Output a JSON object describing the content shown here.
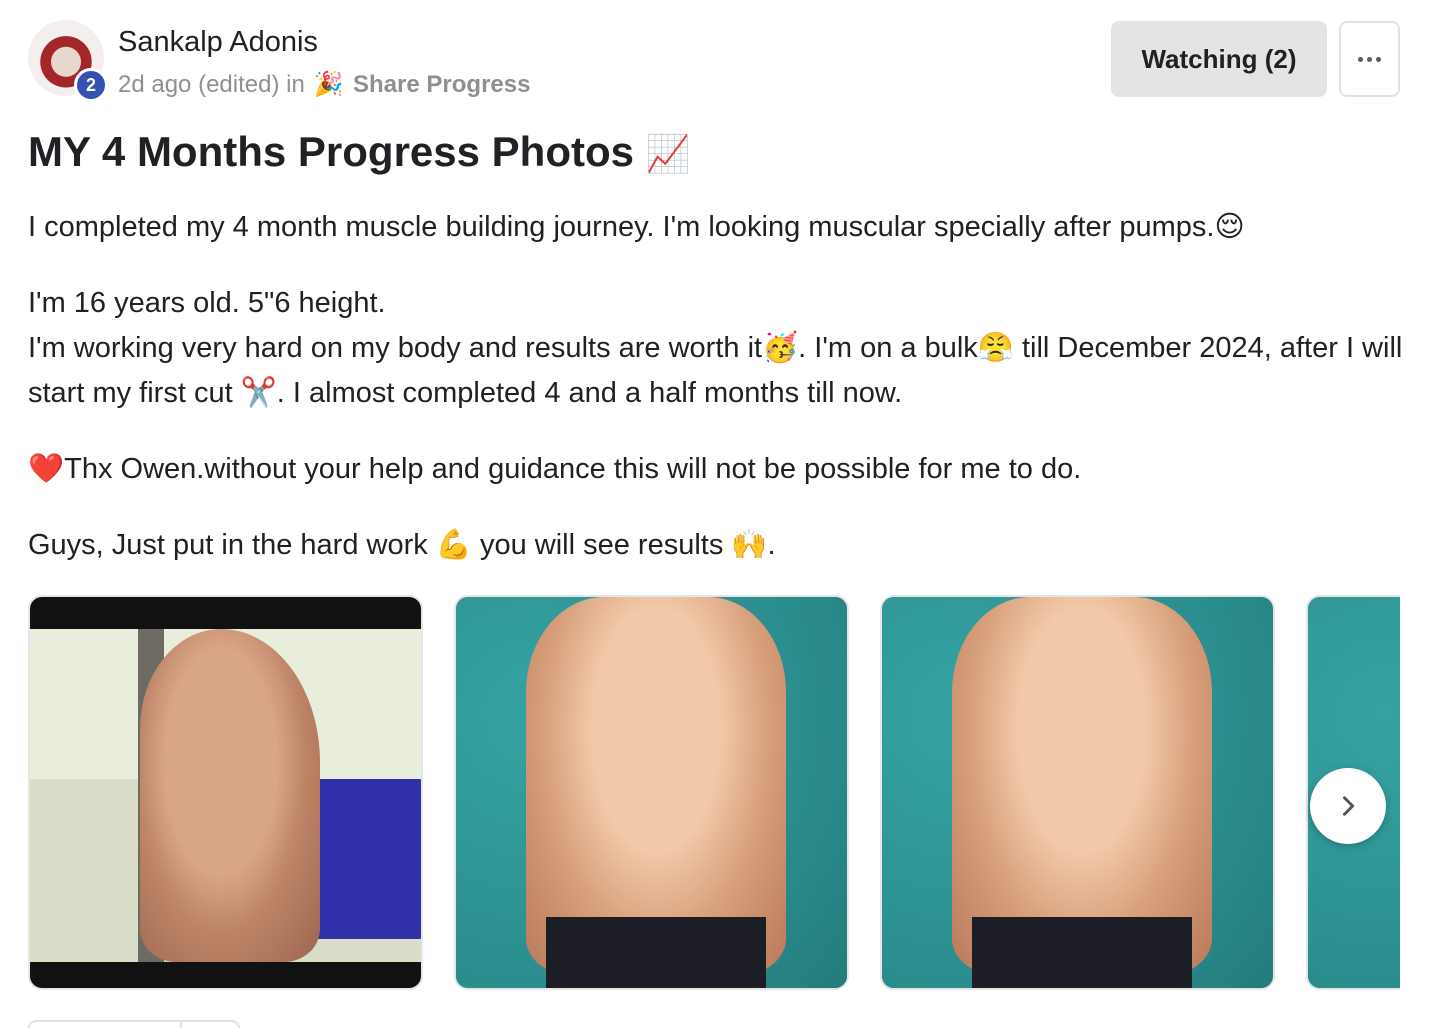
{
  "post": {
    "author": "Sankalp Adonis",
    "level": "2",
    "time": "2d ago (edited) in",
    "category_icon": "🎉",
    "category": "Share Progress",
    "watch_label": "Watching (2)",
    "more_icon": "ellipsis-icon",
    "title": "MY 4 Months Progress Photos",
    "title_icon": "📈",
    "paragraphs": [
      "I completed my 4 month muscle building journey. I'm looking muscular specially after pumps.😌",
      "I'm 16 years old. 5\"6 height.",
      "I'm working very hard on my body and results are worth it🥳. I'm on a bulk😤 till December 2024, after I will start my first cut ✂️. I almost completed 4 and a half months till now.",
      "❤️Thx Owen.without your help and guidance this will not be possible for me to do.",
      "Guys, Just put in the hard work 💪 you will see results 🙌."
    ]
  },
  "gallery": {
    "photos": [
      "progress-photo-side",
      "progress-photo-front",
      "progress-photo-front-2",
      "progress-photo-4"
    ],
    "next_icon": "chevron-right-icon"
  },
  "colors": {
    "level_badge": "#3552b3",
    "button_bg": "#e4e4e4"
  }
}
